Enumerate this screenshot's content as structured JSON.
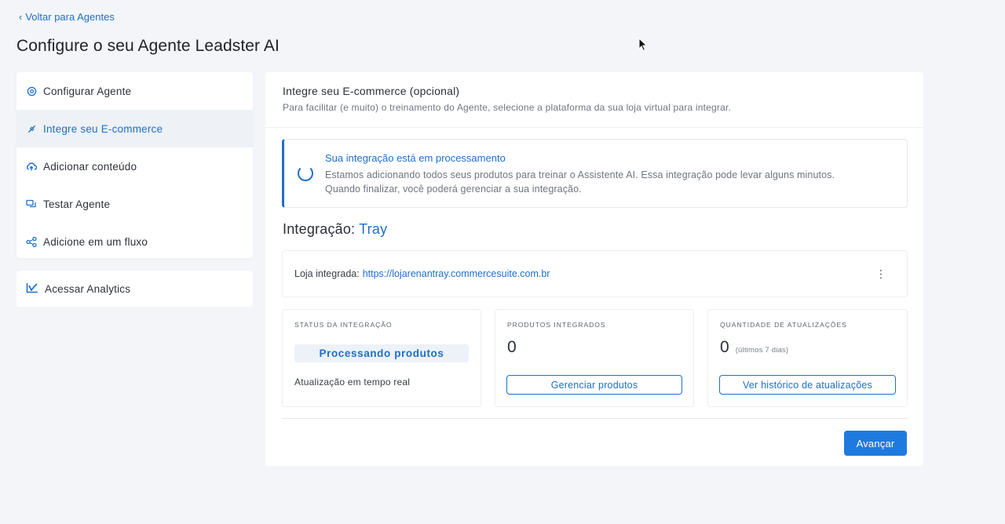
{
  "header": {
    "back_label": "Voltar para Agentes",
    "title": "Configure o seu Agente Leadster AI"
  },
  "sidebar": {
    "items": [
      {
        "label": "Configurar Agente",
        "icon": "gear-icon",
        "active": false
      },
      {
        "label": "Integre seu E-commerce",
        "icon": "plug-icon",
        "active": true
      },
      {
        "label": "Adicionar conteúdo",
        "icon": "cloud-upload-icon",
        "active": false
      },
      {
        "label": "Testar Agente",
        "icon": "chat-icon",
        "active": false
      },
      {
        "label": "Adicione em um fluxo",
        "icon": "share-icon",
        "active": false
      }
    ],
    "analytics_label": "Acessar Analytics"
  },
  "main": {
    "title": "Integre seu E-commerce (opcional)",
    "subtitle": "Para facilitar (e muito) o treinamento do Agente, selecione a plataforma da sua loja virtual para integrar.",
    "alert": {
      "title": "Sua integração está em processamento",
      "line1": "Estamos adicionando todos seus produtos para treinar o Assistente AI. Essa integração pode levar alguns minutos.",
      "line2": "Quando finalizar, você poderá gerenciar a sua integração."
    },
    "integration": {
      "label": "Integração:",
      "platform": "Tray"
    },
    "store": {
      "label": "Loja integrada:",
      "url": "https://lojarenantray.commercesuite.com.br"
    },
    "stats": {
      "status": {
        "label": "Status da integração",
        "value": "Processando produtos",
        "footnote": "Atualização em tempo real"
      },
      "products": {
        "label": "Produtos integrados",
        "value": "0",
        "button": "Gerenciar produtos"
      },
      "updates": {
        "label": "Quantidade de atualizações",
        "value": "0",
        "sub": "(últimos 7 dias)",
        "button": "Ver histórico de atualizações"
      }
    },
    "next_button": "Avançar"
  },
  "colors": {
    "accent": "#1f6fc9",
    "primary_button": "#1f7ae0",
    "background": "#f4f5f8"
  }
}
